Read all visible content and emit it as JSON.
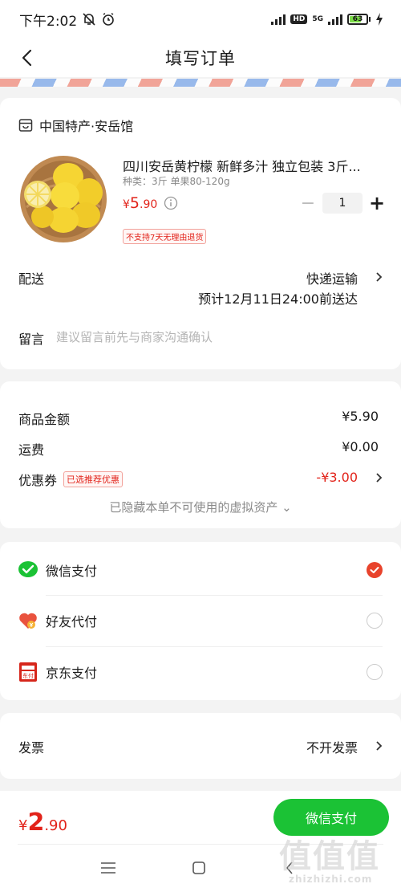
{
  "status_bar": {
    "time": "下午2:02",
    "network": "5G",
    "hd": "HD",
    "battery": "63",
    "battery_level": 0.63
  },
  "header": {
    "title": "填写订单"
  },
  "shop": {
    "name": "中国特产·安岳馆",
    "product": {
      "title": "四川安岳黄柠檬 新鲜多汁 独立包装 3斤...",
      "spec": "种类：3斤 单果80-120g",
      "price_currency": "¥",
      "price_int": "5",
      "price_dec": ".90",
      "quantity": "1",
      "minus_label": "−",
      "plus_label": "+",
      "return_tag": "不支持7天无理由退货"
    },
    "shipping": {
      "label": "配送",
      "method": "快递运输",
      "eta": "预计12月11日24:00前送达"
    },
    "note": {
      "label": "留言",
      "placeholder": "建议留言前先与商家沟通确认",
      "value": ""
    }
  },
  "amounts": {
    "goods_label": "商品金额",
    "goods_value": "¥5.90",
    "freight_label": "运费",
    "freight_value": "¥0.00",
    "coupon_label": "优惠券",
    "coupon_tag": "已选推荐优惠",
    "coupon_value": "-¥3.00",
    "hidden_assets": "已隐藏本单不可使用的虚拟资产 ⌄"
  },
  "payment": {
    "methods": [
      {
        "label": "微信支付",
        "selected": true
      },
      {
        "label": "好友代付",
        "selected": false
      },
      {
        "label": "京东支付",
        "selected": false
      }
    ],
    "jd_icon_text": "东付"
  },
  "invoice": {
    "label": "发票",
    "value": "不开发票"
  },
  "bottom": {
    "currency": "¥",
    "total_int": "2",
    "total_dec": ".90",
    "pay_button": "微信支付"
  },
  "watermark": {
    "big": "值值值",
    "small": "zhizhizhi.com"
  },
  "colors": {
    "accent_red": "#e2231a",
    "wechat_green": "#1bc235",
    "radio_selected": "#e8432c"
  }
}
